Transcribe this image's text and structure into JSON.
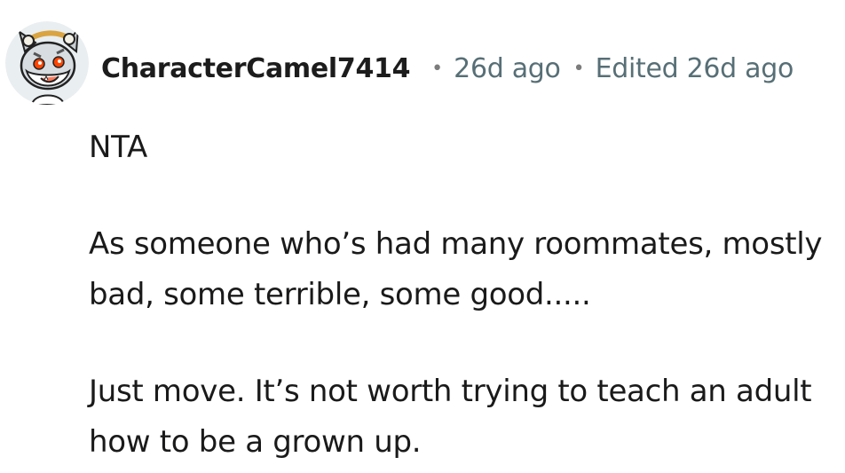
{
  "comment": {
    "author": "CharacterCamel7414",
    "separator": "•",
    "time": "26d ago",
    "edited": "Edited 26d ago",
    "paragraphs": [
      "NTA",
      "As someone who’s had many roommates, mostly bad, some terrible, some good.....",
      "Just move. It’s not worth trying to teach an adult how to be a grown up."
    ]
  },
  "colors": {
    "author": "#1c1c1c",
    "meta": "#576f76",
    "body_text": "#1a1a1b",
    "avatar_bg": "#e9eef0",
    "avatar_eye": "#ff4500"
  },
  "icons": {
    "avatar": "snoo-wolf-avatar-icon"
  }
}
